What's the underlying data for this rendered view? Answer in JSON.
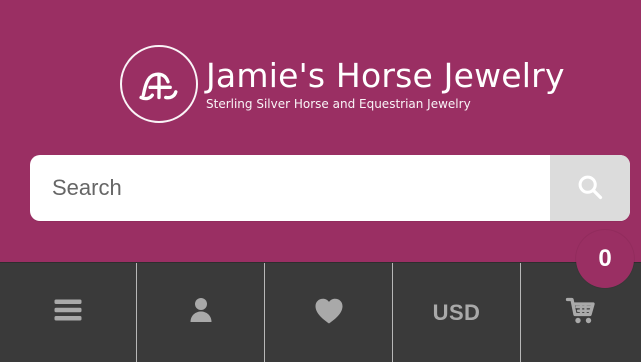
{
  "colors": {
    "header_bg": "#9a2f63",
    "toolbar_bg": "#3a3a3a",
    "icon_gray": "#aaaaaa",
    "search_button_bg": "#dcdcdc",
    "badge_bg": "#9a2f63"
  },
  "logo": {
    "title": "Jamie's Horse Jewelry",
    "subtitle": "Sterling Silver Horse and Equestrian Jewelry",
    "mark_icon": "ja-monogram-icon"
  },
  "search": {
    "placeholder": "Search",
    "button_icon": "search-icon"
  },
  "toolbar": {
    "items": [
      {
        "icon": "menu-icon"
      },
      {
        "icon": "account-icon"
      },
      {
        "icon": "wishlist-heart-icon"
      },
      {
        "label": "USD"
      },
      {
        "icon": "cart-icon"
      }
    ],
    "cart_count": "0"
  }
}
